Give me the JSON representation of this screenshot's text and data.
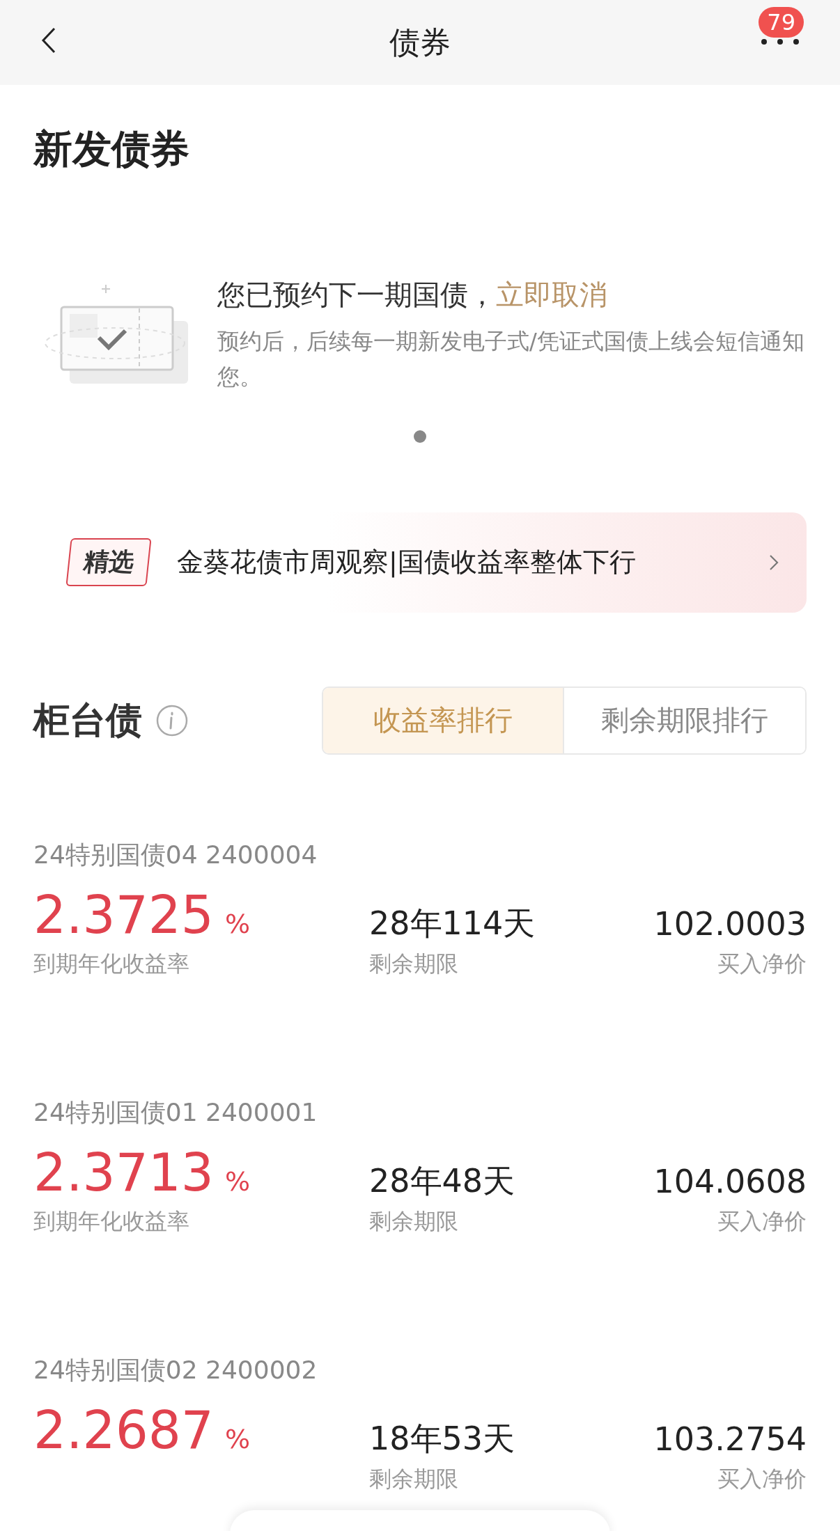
{
  "nav": {
    "title": "债券",
    "badge": "79"
  },
  "new_bonds": {
    "title": "新发债券",
    "notice": {
      "text": "您已预约下一期国债，",
      "action": "立即取消",
      "description": "预约后，后续每一期新发电子式/凭证式国债上线会短信通知您。"
    },
    "pager": [
      {
        "selected": true
      }
    ]
  },
  "banner": {
    "tag": "精选",
    "text": "金葵花债市周观察|国债收益率整体下行"
  },
  "counter_bonds": {
    "title": "柜台债",
    "tabs": [
      {
        "label": "收益率排行",
        "selected": true
      },
      {
        "label": "剩余期限排行",
        "selected": false
      }
    ],
    "items": [
      {
        "name": "24特别国债04  2400004",
        "yield": "2.3725",
        "unit": "%",
        "yield_label": "到期年化收益率",
        "term": "28年114天",
        "term_label": "剩余期限",
        "price": "102.0003",
        "price_label": "买入净价"
      },
      {
        "name": "24特别国债01  2400001",
        "yield": "2.3713",
        "unit": "%",
        "yield_label": "到期年化收益率",
        "term": "28年48天",
        "term_label": "剩余期限",
        "price": "104.0608",
        "price_label": "买入净价"
      },
      {
        "name": "24特别国债02  2400002",
        "yield": "2.2687",
        "unit": "%",
        "term": "18年53天",
        "term_label": "剩余期限",
        "price": "103.2754",
        "price_label": "买入净价"
      }
    ]
  }
}
